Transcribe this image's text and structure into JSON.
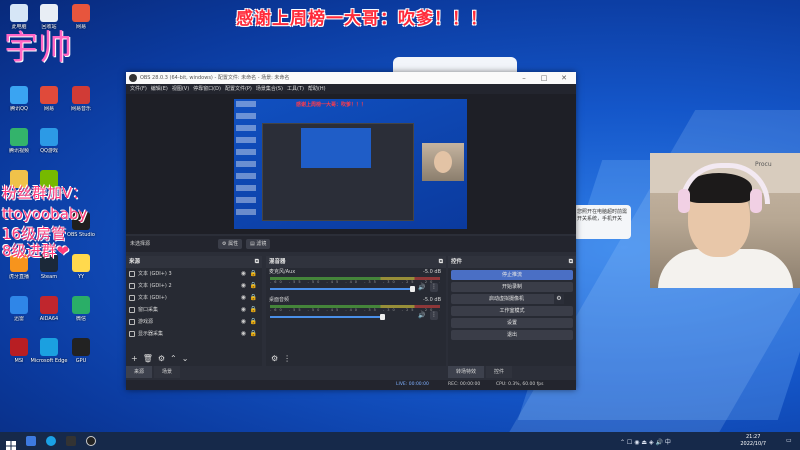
{
  "overlay": {
    "top_banner": "感谢上周榜一大哥：吹爹！！！",
    "name": "宇帅",
    "side_lines": [
      "粉丝群加V：",
      "ttoyoobaby",
      "16级房管",
      "8级进群❤"
    ]
  },
  "desktop_icons": [
    {
      "label": "此电脑",
      "color": "#d6e6f6"
    },
    {
      "label": "回收站",
      "color": "#e8eef5"
    },
    {
      "label": "网易",
      "color": "#e7553d"
    },
    {
      "label": "腾讯QQ",
      "color": "#3aa4f2"
    },
    {
      "label": "网易",
      "color": "#e04a3a"
    },
    {
      "label": "网易音乐",
      "color": "#d13b36"
    },
    {
      "label": "腾讯视频",
      "color": "#33b36b"
    },
    {
      "label": "QQ游戏",
      "color": "#2c9ae6"
    },
    {
      "label": "OBS Studio",
      "color": "#1f1f1f"
    },
    {
      "label": "文件管理",
      "color": "#f0c24a"
    },
    {
      "label": "GeForce Experience",
      "color": "#76b900"
    },
    {
      "label": "YY",
      "color": "#ffd94d"
    },
    {
      "label": "虎牙直播",
      "color": "#f7941d"
    },
    {
      "label": "Steam",
      "color": "#1b2838"
    },
    {
      "label": "微信",
      "color": "#2aae67"
    },
    {
      "label": "迅雷",
      "color": "#2f86e8"
    },
    {
      "label": "AIDA64",
      "color": "#c0262d"
    },
    {
      "label": "GPU",
      "color": "#222222"
    },
    {
      "label": "MSI",
      "color": "#b81e23"
    },
    {
      "label": "Microsoft Edge",
      "color": "#1ba0e0"
    }
  ],
  "notification": {
    "text": "您照开在电脑超时前需开关系统，手机开关"
  },
  "obs": {
    "title": "OBS 28.0.3 (64-bit, windows) - 配置文件: 未命名 - 场景: 未命名",
    "menu": [
      "文件(F)",
      "编辑(E)",
      "视图(V)",
      "停靠窗口(D)",
      "配置文件(P)",
      "场景集合(S)",
      "工具(T)",
      "帮助(H)"
    ],
    "preview_banner": "感谢上周榜一大哥：吹爹！！！",
    "no_source": "未选择源",
    "props_btn": "属性",
    "filters_btn": "滤镜",
    "sources_title": "来源",
    "sources": [
      "文本 (GDI+) 3",
      "文本 (GDI+) 2",
      "文本 (GDI+)",
      "窗口采集",
      "游戏源",
      "显示器采集"
    ],
    "mixer_title": "混音器",
    "mixer": [
      {
        "name": "麦克风/Aux",
        "db": "-5.0 dB"
      },
      {
        "name": "桌面音频",
        "db": "-5.0 dB"
      }
    ],
    "mixer_scale": "-60 -55 -50 -45 -40 -35 -30 -25 -20 -15 -10 -5 0",
    "controls_title": "控件",
    "controls": [
      "停止推流",
      "开始录制",
      "启动虚拟摄像机",
      "工作室模式",
      "设置",
      "退出"
    ],
    "bottom_tabs_left": [
      "来源",
      "场景"
    ],
    "bottom_tabs_right": [
      "转场特效",
      "控件"
    ],
    "status": {
      "live": "LIVE: 00:00:00",
      "rec": "REC: 00:00:00",
      "cpu": "CPU: 0.3%, 60.00 fps"
    }
  },
  "taskbar": {
    "time": "21:27",
    "date": "2022/10/7"
  }
}
